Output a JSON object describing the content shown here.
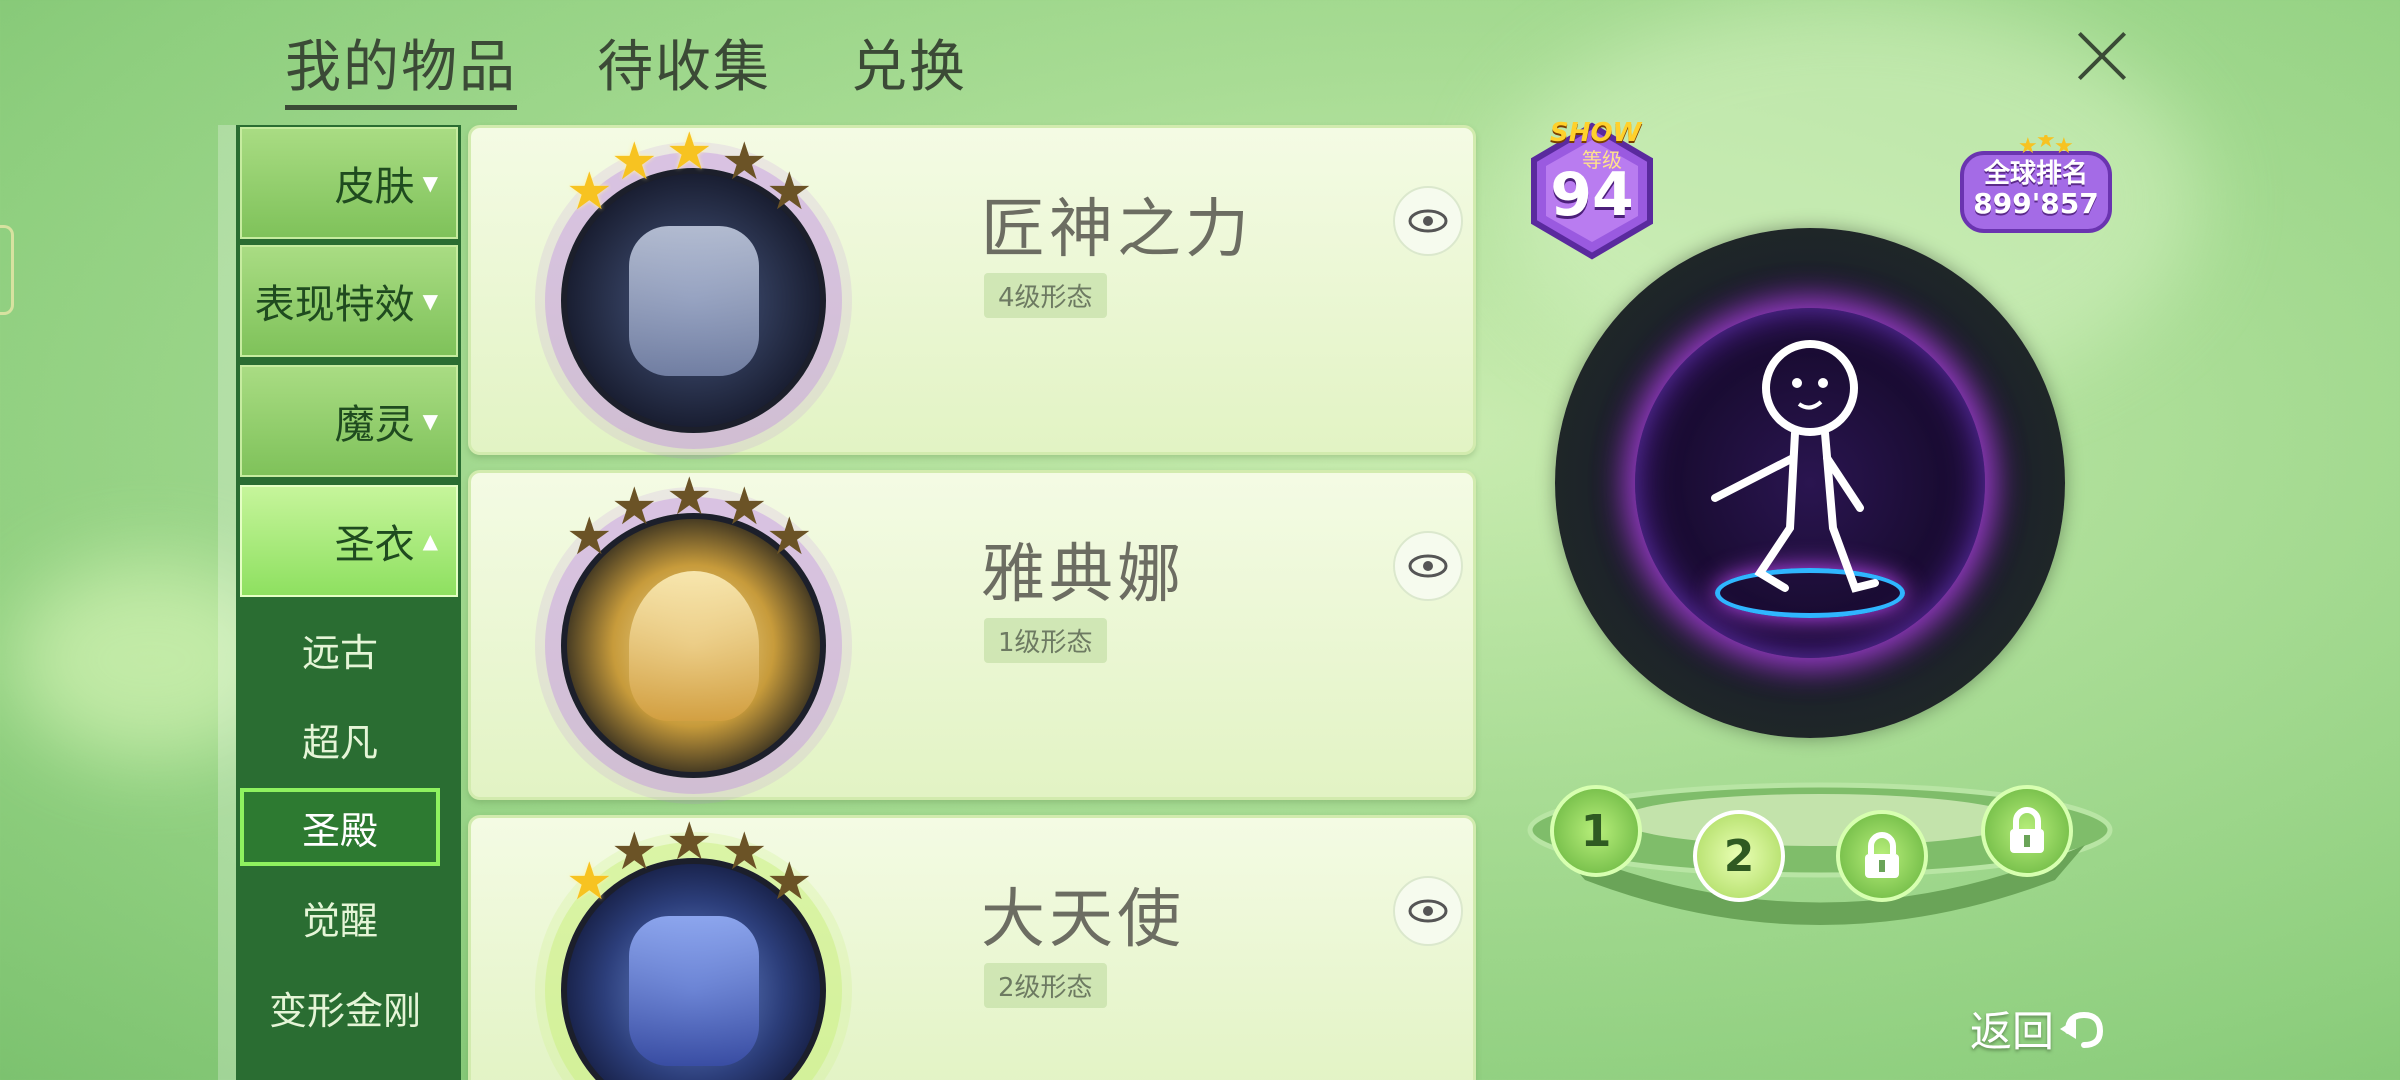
{
  "colors": {
    "background": "#a8dc94",
    "sidebar_dark": "#2a6d32",
    "category_green": "#8fcf6a",
    "selected_border": "#8ef25f",
    "star_gold": "#f7c321",
    "star_dark": "#6b5326"
  },
  "tabs": [
    {
      "label": "我的物品",
      "active": true
    },
    {
      "label": "待收集",
      "active": false
    },
    {
      "label": "兑换",
      "active": false
    }
  ],
  "categories": [
    {
      "label": "皮肤",
      "arrow": "▼"
    },
    {
      "label": "表现特效",
      "arrow": "▼"
    },
    {
      "label": "魔灵",
      "arrow": "▼"
    },
    {
      "label": "圣衣",
      "arrow": "▲"
    }
  ],
  "subcategories": [
    {
      "label": "远古"
    },
    {
      "label": "超凡"
    },
    {
      "label": "圣殿",
      "selected": true
    },
    {
      "label": "觉醒"
    },
    {
      "label": "变形金刚"
    }
  ],
  "items": [
    {
      "name": "匠神之力",
      "form": "4级形态",
      "stars_total": 5,
      "stars_gold": 3
    },
    {
      "name": "雅典娜",
      "form": "1级形态",
      "stars_total": 5,
      "stars_gold": 0
    },
    {
      "name": "大天使",
      "form": "2级形态",
      "stars_total": 5,
      "stars_gold": 1
    }
  ],
  "profile": {
    "show_label": "SHOW",
    "level_label": "等级",
    "level": "94",
    "rank_label": "全球排名",
    "rank_value": "899'857"
  },
  "preview_slots": [
    {
      "label": "1",
      "state": "unlocked"
    },
    {
      "label": "2",
      "state": "selected"
    },
    {
      "label": "",
      "state": "locked"
    },
    {
      "label": "",
      "state": "locked"
    }
  ],
  "back_label": "返回"
}
